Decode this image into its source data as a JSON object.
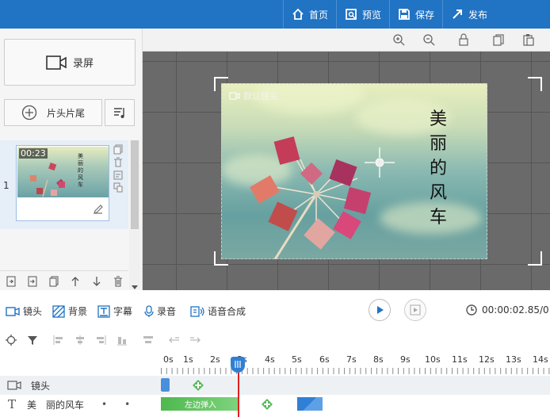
{
  "topbar": {
    "menu": [
      {
        "label": "首页",
        "icon": "home-icon"
      },
      {
        "label": "预览",
        "icon": "preview-icon"
      },
      {
        "label": "保存",
        "icon": "save-icon"
      },
      {
        "label": "发布",
        "icon": "share-icon"
      }
    ]
  },
  "left": {
    "record_label": "录屏",
    "head_tail_label": "片头片尾",
    "scene_number": "1",
    "scene_time": "00:23",
    "scene_title": "美丽的风车"
  },
  "stage": {
    "camera_label": "默认镜头",
    "title": "美丽的风车"
  },
  "timeline_toolbar": {
    "items": [
      {
        "label": "镜头",
        "icon": "camera-icon"
      },
      {
        "label": "背景",
        "icon": "background-icon"
      },
      {
        "label": "字幕",
        "icon": "subtitle-icon"
      },
      {
        "label": "录音",
        "icon": "microphone-icon"
      },
      {
        "label": "语音合成",
        "icon": "speech-synthesis-icon"
      }
    ],
    "timecode": "00:00:02.85/0"
  },
  "ruler": {
    "ticks": [
      "0s",
      "1s",
      "2s",
      "3s",
      "4s",
      "5s",
      "6s",
      "7s",
      "8s",
      "9s",
      "10s",
      "11s",
      "12s",
      "13s",
      "14s"
    ]
  },
  "tracks": {
    "camera_label": "镜头",
    "text_label": "美　丽的风车",
    "text_clip_label": "左边弹入"
  },
  "colors": {
    "topbar": "#2173c3",
    "accent": "#2f7fd6",
    "clip_green": "#5cb85c",
    "playhead": "#e02020"
  }
}
